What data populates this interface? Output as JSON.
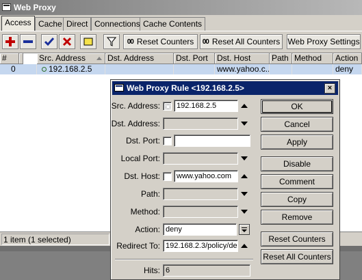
{
  "main": {
    "title": "Web Proxy",
    "tabs": [
      "Access",
      "Cache",
      "Direct",
      "Connections",
      "Cache Contents"
    ],
    "toolbar": {
      "reset_counters": "Reset Counters",
      "reset_all_counters": "Reset All Counters",
      "web_proxy_settings": "Web Proxy Settings",
      "counter_icon": "00"
    },
    "columns": [
      "#",
      "Src. Address",
      "Dst. Address",
      "Dst. Port",
      "Dst. Host",
      "Path",
      "Method",
      "Action"
    ],
    "rows": [
      {
        "num": "0",
        "src": "192.168.2.5",
        "dst": "",
        "port": "",
        "host": "www.yahoo.c...",
        "path": "",
        "method": "",
        "action": "deny"
      }
    ],
    "status": "1 item (1 selected)"
  },
  "dialog": {
    "title": "Web Proxy Rule <192.168.2.5>",
    "close": "×",
    "labels": {
      "src": "Src. Address:",
      "dst": "Dst. Address:",
      "dst_port": "Dst. Port:",
      "local_port": "Local Port:",
      "dst_host": "Dst. Host:",
      "path": "Path:",
      "method": "Method:",
      "action": "Action:",
      "redirect": "Redirect To:",
      "hits": "Hits:"
    },
    "values": {
      "src": "192.168.2.5",
      "dst_port": "",
      "dst_host": "www.yahoo.com",
      "action": "deny",
      "redirect": "192.168.2.3/policy/de",
      "hits": "6"
    },
    "buttons": [
      "OK",
      "Cancel",
      "Apply",
      "Disable",
      "Comment",
      "Copy",
      "Remove",
      "Reset Counters",
      "Reset All Counters"
    ]
  },
  "colors": {
    "dialog_title": "#0a246a",
    "selected_row": "#c5d7ef",
    "window_bg": "#d4d0c8"
  }
}
